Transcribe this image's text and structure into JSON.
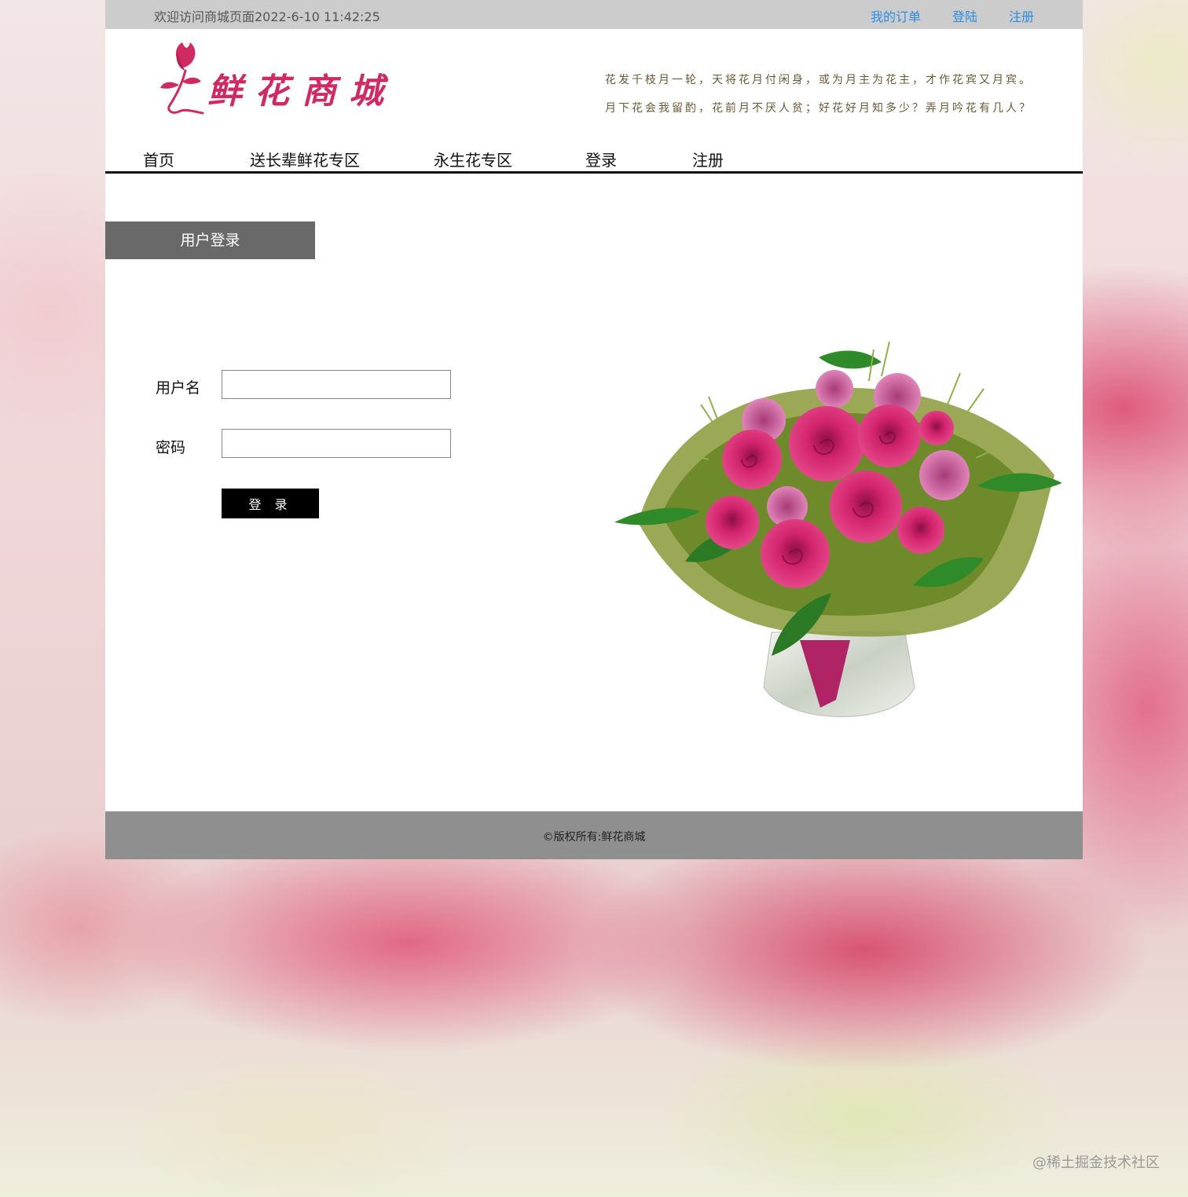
{
  "topbar": {
    "welcome": "欢迎访问商城页面2022-6-10 11:42:25",
    "links": [
      "我的订单",
      "登陆",
      "注册"
    ]
  },
  "header": {
    "logo_text": "鲜花商城",
    "poem_lines": [
      "花发千枝月一轮，天将花月付闲身，或为月主为花主，才作花宾又月宾。",
      "月下花会我留酌，花前月不厌人贫；好花好月知多少？弄月吟花有几人？"
    ]
  },
  "nav": {
    "items": [
      "首页",
      "送长辈鲜花专区",
      "永生花专区",
      "登录",
      "注册"
    ]
  },
  "login": {
    "heading": "用户登录",
    "username_label": "用户名",
    "password_label": "密码",
    "username_value": "",
    "password_value": "",
    "submit_label": "登 录"
  },
  "footer": {
    "copyright": "©版权所有:鲜花商城"
  },
  "watermark": "@稀土掘金技术社区",
  "colors": {
    "link": "#2c8de0",
    "brand": "#d02a63",
    "topbar_bg": "#cccccc",
    "heading_bg": "#696969",
    "footer_bg": "#8f8f8f"
  }
}
